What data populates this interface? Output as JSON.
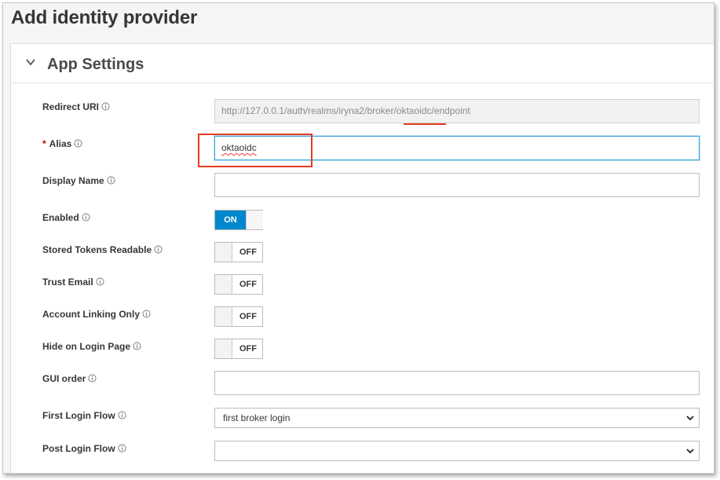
{
  "page": {
    "title": "Add identity provider"
  },
  "section": {
    "title": "App Settings"
  },
  "form": {
    "redirect_uri": {
      "label": "Redirect URI",
      "value": "http://127.0.0.1/auth/realms/iryna2/broker/oktaoidc/endpoint"
    },
    "alias": {
      "label": "Alias",
      "required_marker": "*",
      "value": "oktaoidc"
    },
    "display_name": {
      "label": "Display Name",
      "value": ""
    },
    "enabled": {
      "label": "Enabled",
      "state": "ON"
    },
    "stored_tokens_readable": {
      "label": "Stored Tokens Readable",
      "state": "OFF"
    },
    "trust_email": {
      "label": "Trust Email",
      "state": "OFF"
    },
    "account_linking_only": {
      "label": "Account Linking Only",
      "state": "OFF"
    },
    "hide_on_login_page": {
      "label": "Hide on Login Page",
      "state": "OFF"
    },
    "gui_order": {
      "label": "GUI order",
      "value": ""
    },
    "first_login_flow": {
      "label": "First Login Flow",
      "selected": "first broker login"
    },
    "post_login_flow": {
      "label": "Post Login Flow",
      "selected": ""
    }
  },
  "colors": {
    "toggle_on": "#0088ce",
    "annotation": "#e53a22",
    "focus": "#39a5dc"
  },
  "icons": {
    "section_toggle": "chevron-down-icon",
    "help": "info-icon",
    "dropdown": "caret-down-icon"
  }
}
